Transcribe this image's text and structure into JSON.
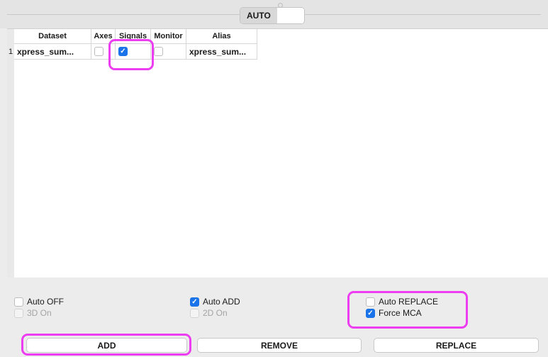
{
  "topbar": {
    "mode_selected": "AUTO"
  },
  "table": {
    "columns": [
      "Dataset",
      "Axes",
      "Signals",
      "Monitor",
      "Alias"
    ],
    "rows": [
      {
        "index": "1",
        "dataset": "xpress_sum...",
        "axes": false,
        "signals": true,
        "monitor": false,
        "alias": "xpress_sum..."
      }
    ]
  },
  "options": {
    "auto_off": "Auto OFF",
    "three_d_on": "3D On",
    "auto_add": "Auto ADD",
    "two_d_on": "2D On",
    "auto_replace": "Auto REPLACE",
    "force_mca": "Force MCA"
  },
  "buttons": {
    "add": "ADD",
    "remove": "REMOVE",
    "replace": "REPLACE"
  },
  "colors": {
    "checkbox_on": "#1a73e8",
    "highlight": "#ec3ef0"
  }
}
